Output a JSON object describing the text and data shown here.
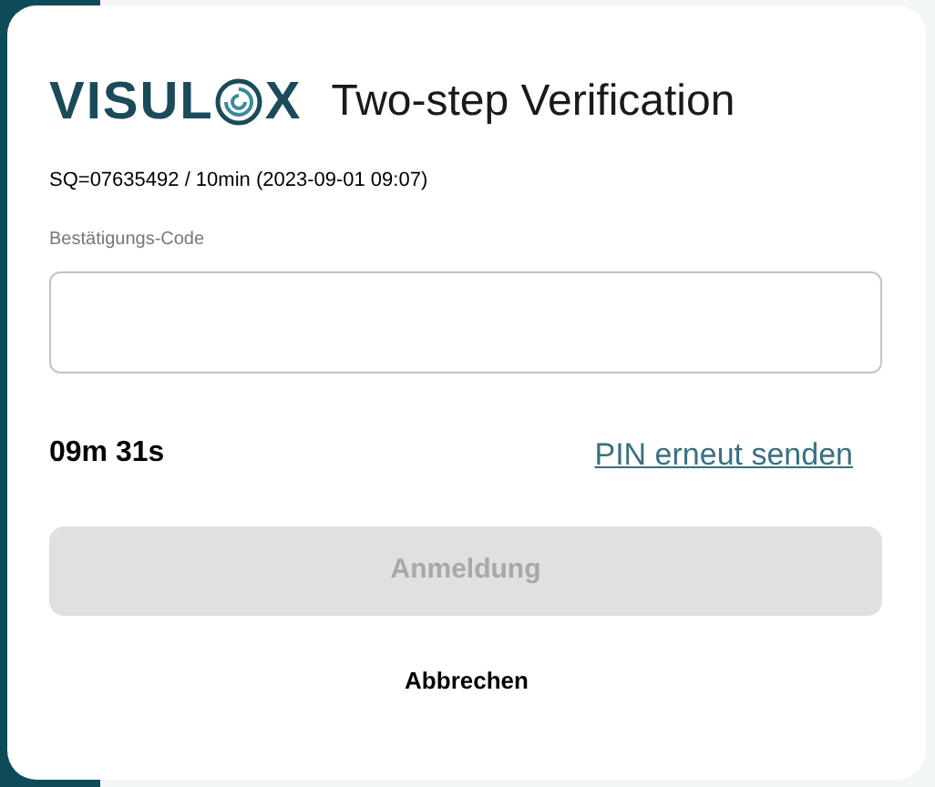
{
  "logo": {
    "text_start": "VISUL",
    "text_end": "X"
  },
  "title": "Two-step Verification",
  "request_info": "SQ=07635492 / 10min (2023-09-01 09:07)",
  "code_field": {
    "label": "Bestätigungs-Code"
  },
  "timer": "09m 31s",
  "resend_link": "PIN erneut senden",
  "submit_button": {
    "label": "Anmeldung",
    "disabled": true
  },
  "cancel_button": "Abbrechen"
}
